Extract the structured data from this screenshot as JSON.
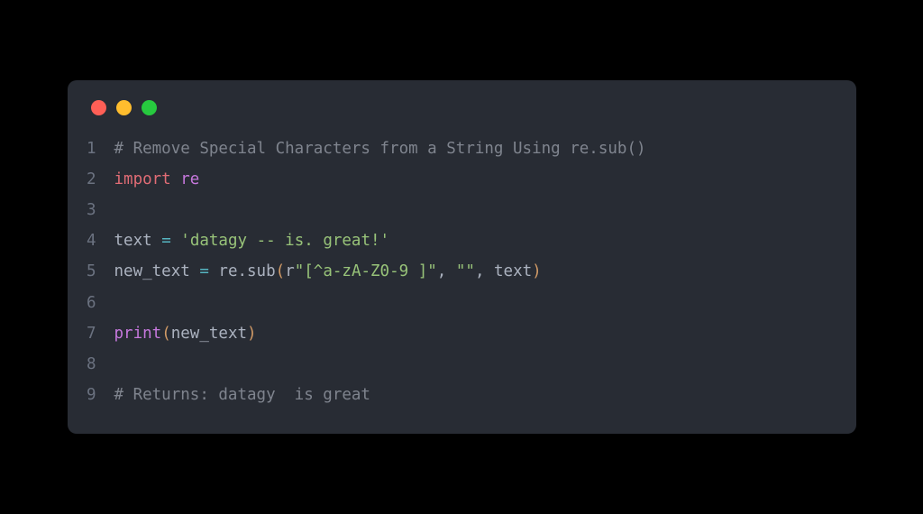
{
  "window": {
    "dots": [
      "red",
      "yellow",
      "green"
    ]
  },
  "code": {
    "lines": [
      {
        "num": "1",
        "tokens": [
          {
            "t": "# Remove Special Characters from a String Using re.sub()",
            "c": "comment"
          }
        ]
      },
      {
        "num": "2",
        "tokens": [
          {
            "t": "import",
            "c": "keyword"
          },
          {
            "t": " ",
            "c": "ident"
          },
          {
            "t": "re",
            "c": "module"
          }
        ]
      },
      {
        "num": "3",
        "tokens": []
      },
      {
        "num": "4",
        "tokens": [
          {
            "t": "text ",
            "c": "ident"
          },
          {
            "t": "=",
            "c": "operator"
          },
          {
            "t": " ",
            "c": "ident"
          },
          {
            "t": "'datagy -- is. great!'",
            "c": "string"
          }
        ]
      },
      {
        "num": "5",
        "tokens": [
          {
            "t": "new_text ",
            "c": "ident"
          },
          {
            "t": "=",
            "c": "operator"
          },
          {
            "t": " re.sub",
            "c": "ident"
          },
          {
            "t": "(",
            "c": "paren"
          },
          {
            "t": "r",
            "c": "prefix"
          },
          {
            "t": "\"[^a-zA-Z0-9 ]\"",
            "c": "string"
          },
          {
            "t": ", ",
            "c": "ident"
          },
          {
            "t": "\"\"",
            "c": "string"
          },
          {
            "t": ", text",
            "c": "ident"
          },
          {
            "t": ")",
            "c": "paren"
          }
        ]
      },
      {
        "num": "6",
        "tokens": []
      },
      {
        "num": "7",
        "tokens": [
          {
            "t": "print",
            "c": "builtin"
          },
          {
            "t": "(",
            "c": "paren"
          },
          {
            "t": "new_text",
            "c": "ident"
          },
          {
            "t": ")",
            "c": "paren"
          }
        ]
      },
      {
        "num": "8",
        "tokens": []
      },
      {
        "num": "9",
        "tokens": [
          {
            "t": "# Returns: datagy  is great",
            "c": "comment"
          }
        ]
      }
    ]
  }
}
